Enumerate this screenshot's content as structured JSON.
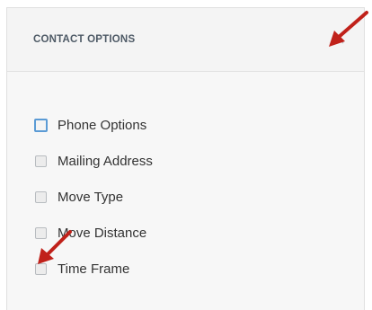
{
  "panel": {
    "title": "CONTACT OPTIONS",
    "collapse_icon": "chevron-icon"
  },
  "options": [
    {
      "label": "Phone Options",
      "checked": false,
      "focused": true
    },
    {
      "label": "Mailing Address",
      "checked": false,
      "focused": false
    },
    {
      "label": "Move Type",
      "checked": false,
      "focused": false
    },
    {
      "label": "Move Distance",
      "checked": false,
      "focused": false
    },
    {
      "label": "Time Frame",
      "checked": false,
      "focused": false
    }
  ],
  "colors": {
    "arrow": "#c0211a",
    "focus_ring": "#5b9bd5",
    "title_text": "#4e5a66"
  }
}
